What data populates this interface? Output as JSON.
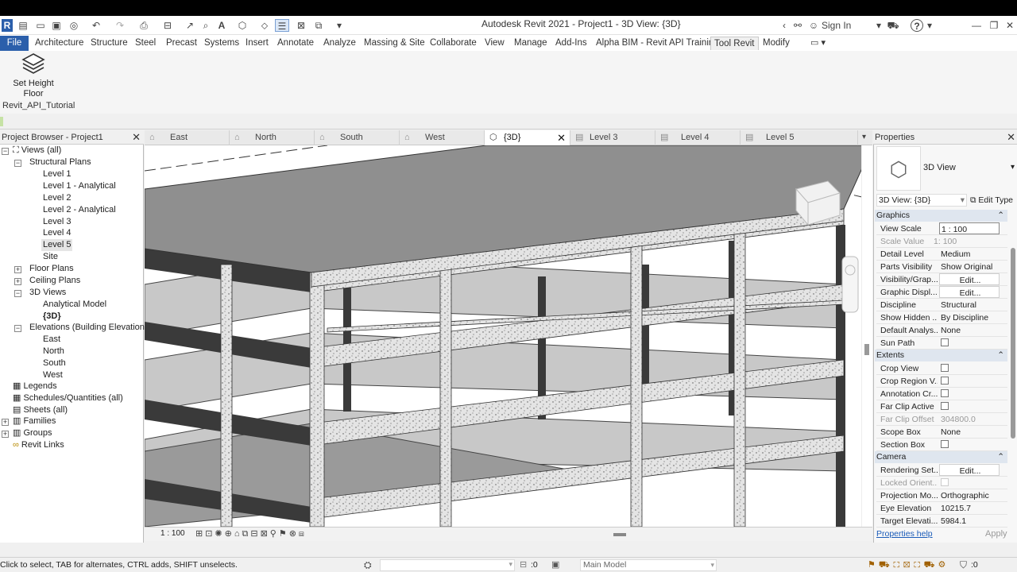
{
  "title": "Autodesk Revit 2021 - Project1 - 3D View: {3D}",
  "sign_in": "Sign In",
  "help": "?",
  "tabs": [
    {
      "label": "File"
    },
    {
      "label": "Architecture"
    },
    {
      "label": "Structure"
    },
    {
      "label": "Steel"
    },
    {
      "label": "Precast"
    },
    {
      "label": "Systems"
    },
    {
      "label": "Insert"
    },
    {
      "label": "Annotate"
    },
    {
      "label": "Analyze"
    },
    {
      "label": "Massing & Site"
    },
    {
      "label": "Collaborate"
    },
    {
      "label": "View"
    },
    {
      "label": "Manage"
    },
    {
      "label": "Add-Ins"
    },
    {
      "label": "Alpha BIM - Revit API Training"
    },
    {
      "label": "Tool Revit"
    },
    {
      "label": "Modify"
    }
  ],
  "ribbon": {
    "button_line1": "Set Height",
    "button_line2": "Floor",
    "panel_label": "Revit_API_Tutorial",
    "icon": "stacked-layers-icon"
  },
  "browser": {
    "title": "Project Browser - Project1",
    "items": [
      {
        "label": "Views (all)"
      },
      {
        "label": "Structural Plans"
      },
      {
        "label": "Level 1"
      },
      {
        "label": "Level 1 - Analytical"
      },
      {
        "label": "Level 2"
      },
      {
        "label": "Level 2 - Analytical"
      },
      {
        "label": "Level 3"
      },
      {
        "label": "Level 4"
      },
      {
        "label": "Level 5"
      },
      {
        "label": "Site"
      },
      {
        "label": "Floor Plans"
      },
      {
        "label": "Ceiling Plans"
      },
      {
        "label": "3D Views"
      },
      {
        "label": "Analytical Model"
      },
      {
        "label": "{3D}"
      },
      {
        "label": "Elevations (Building Elevation)"
      },
      {
        "label": "East"
      },
      {
        "label": "North"
      },
      {
        "label": "South"
      },
      {
        "label": "West"
      },
      {
        "label": "Legends"
      },
      {
        "label": "Schedules/Quantities (all)"
      },
      {
        "label": "Sheets (all)"
      },
      {
        "label": "Families"
      },
      {
        "label": "Groups"
      },
      {
        "label": "Revit Links"
      }
    ]
  },
  "view_tabs": [
    {
      "label": "East"
    },
    {
      "label": "North"
    },
    {
      "label": "South"
    },
    {
      "label": "West"
    },
    {
      "label": "{3D}"
    },
    {
      "label": "Level 3"
    },
    {
      "label": "Level 4"
    },
    {
      "label": "Level 5"
    }
  ],
  "view_scale": "1 : 100",
  "properties": {
    "title": "Properties",
    "type_name": "3D View",
    "selector": "3D View: {3D}",
    "edit_type": "Edit Type",
    "groups": {
      "graphics": "Graphics",
      "extents": "Extents",
      "camera": "Camera"
    },
    "rows": [
      {
        "k": "View Scale",
        "v": "1 : 100"
      },
      {
        "k": "Scale Value",
        "v": "100",
        "prefix": "1:"
      },
      {
        "k": "Detail Level",
        "v": "Medium"
      },
      {
        "k": "Parts Visibility",
        "v": "Show Original"
      },
      {
        "k": "Visibility/Grap...",
        "v": "Edit..."
      },
      {
        "k": "Graphic Displ...",
        "v": "Edit..."
      },
      {
        "k": "Discipline",
        "v": "Structural"
      },
      {
        "k": "Show Hidden ...",
        "v": "By Discipline"
      },
      {
        "k": "Default Analys...",
        "v": "None"
      },
      {
        "k": "Sun Path",
        "v": ""
      },
      {
        "k": "Crop View",
        "v": ""
      },
      {
        "k": "Crop Region V...",
        "v": ""
      },
      {
        "k": "Annotation Cr...",
        "v": ""
      },
      {
        "k": "Far Clip Active",
        "v": ""
      },
      {
        "k": "Far Clip Offset",
        "v": "304800.0"
      },
      {
        "k": "Scope Box",
        "v": "None"
      },
      {
        "k": "Section Box",
        "v": ""
      },
      {
        "k": "Rendering Set...",
        "v": "Edit..."
      },
      {
        "k": "Locked Orient...",
        "v": ""
      },
      {
        "k": "Projection Mo...",
        "v": "Orthographic"
      },
      {
        "k": "Eye Elevation",
        "v": "10215.7"
      },
      {
        "k": "Target Elevati...",
        "v": "5984.1"
      }
    ],
    "help_link": "Properties help",
    "apply": "Apply"
  },
  "status": {
    "hint": "Click to select, TAB for alternates, CTRL adds, SHIFT unselects.",
    "count": ":0",
    "model": "Main Model",
    "filter": ":0"
  }
}
